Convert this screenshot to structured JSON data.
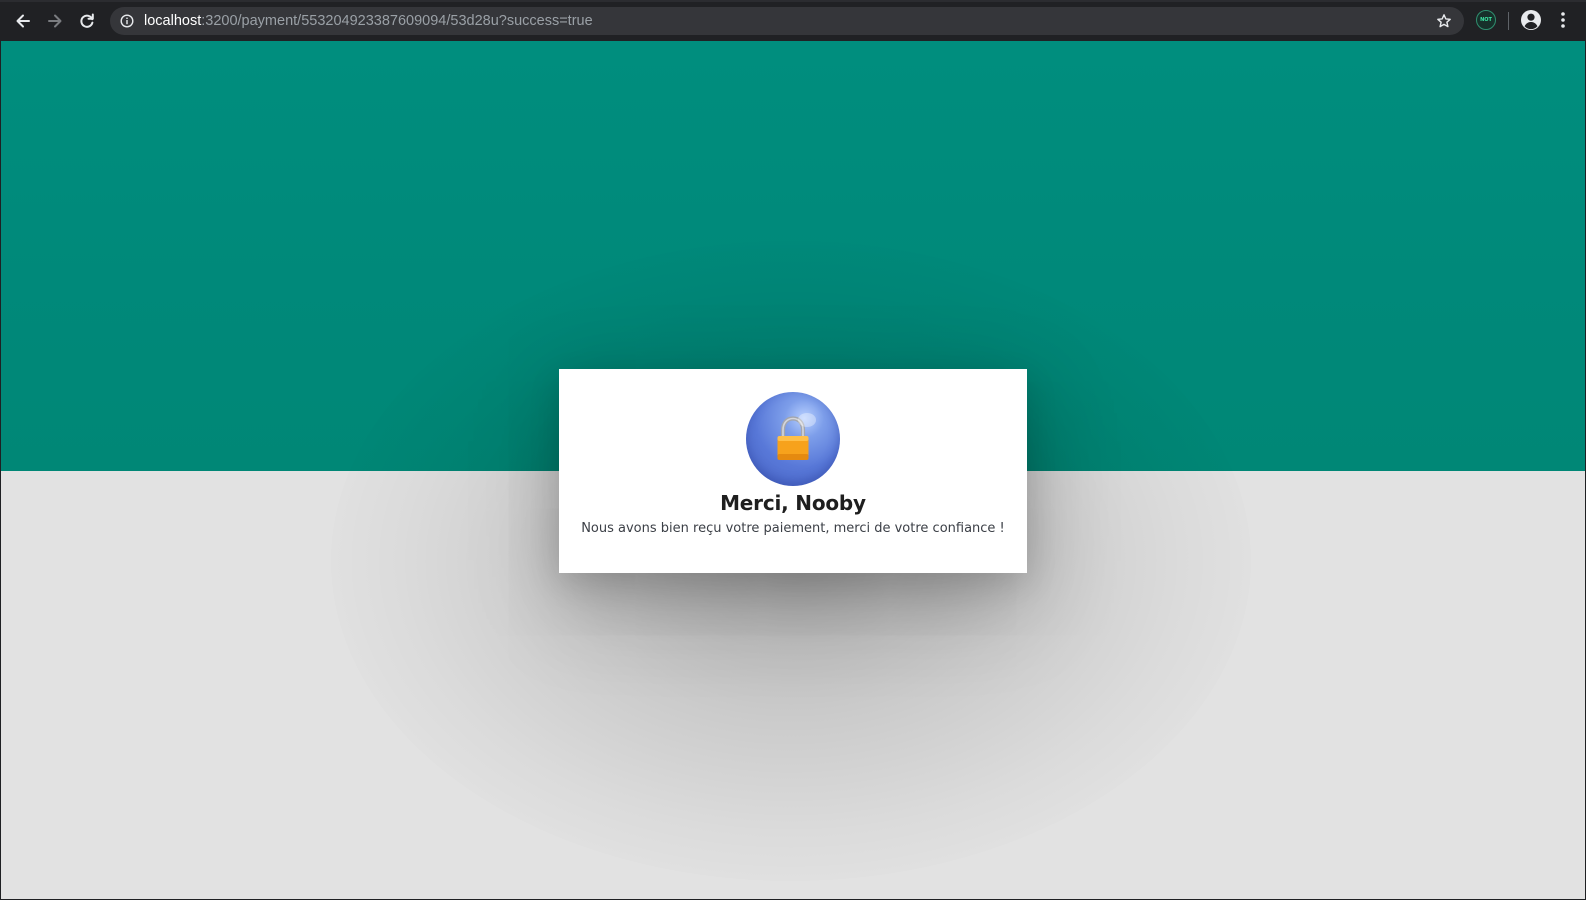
{
  "browser": {
    "url_host": "localhost",
    "url_rest": ":3200/payment/553204923387609094/53d28u?success=true",
    "extension_badge": "NOT"
  },
  "dialog": {
    "title": "Merci, Nooby",
    "message": "Nous avons bien reçu votre paiement, merci de votre confiance !",
    "icon": "lock-icon"
  },
  "colors": {
    "hero": "#008c7c",
    "page_background": "#e2e2e2",
    "avatar": "#5878d8",
    "lock": "#f7a21c"
  }
}
